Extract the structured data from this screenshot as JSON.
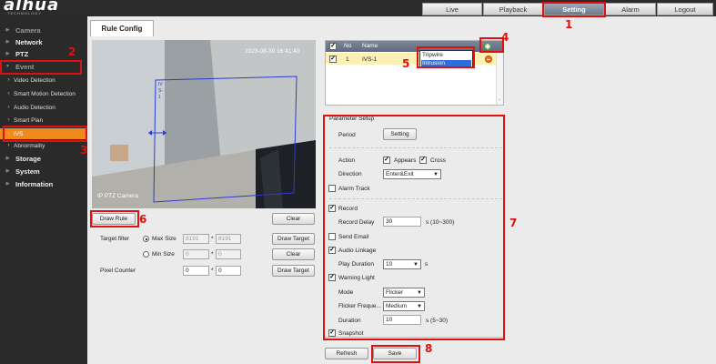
{
  "brand": {
    "logo": "alhua",
    "sub": "TECHNOLOGY"
  },
  "topnav": [
    {
      "label": "Live"
    },
    {
      "label": "Playback"
    },
    {
      "label": "Setting"
    },
    {
      "label": "Alarm"
    },
    {
      "label": "Logout"
    }
  ],
  "sidebar": {
    "camera": "Camera",
    "network": "Network",
    "ptz": "PTZ",
    "event": "Event",
    "video_detection": "Video Detection",
    "smart_motion": "Smart Motion Detection",
    "audio_detection": "Audio Detection",
    "smart_plan": "Smart Plan",
    "ivs": "IVS",
    "abnormality": "Abnormality",
    "storage": "Storage",
    "system": "System",
    "information": "Information"
  },
  "tab": {
    "label": "Rule Config"
  },
  "video": {
    "timestamp": "2023-08-30 16:41:40",
    "camera_label": "IP PTZ Camera",
    "rule_label": "IVS-1"
  },
  "under_video": {
    "draw_rule": "Draw Rule",
    "clear1": "Clear",
    "target_filter": "Target filter",
    "max_size": "Max Size",
    "max_w": "8191",
    "max_h": "8191",
    "draw_target1": "Draw Target",
    "min_size": "Min Size",
    "min_w": "0",
    "min_h": "0",
    "clear2": "Clear",
    "pixel_counter": "Pixel Counter",
    "pix_w": "0",
    "pix_h": "0",
    "draw_target2": "Draw Target",
    "times": "*"
  },
  "rule_table": {
    "col_no": "No",
    "col_name": "Name",
    "row_no": "1",
    "row_name": "IVS-1",
    "dropdown": [
      "Tripwire",
      "Intrusion"
    ]
  },
  "params": {
    "legend": "Parameter Setup",
    "period": "Period",
    "setting_btn": "Setting",
    "action": "Action",
    "appears": "Appears",
    "cross": "Cross",
    "direction": "Direction",
    "direction_val": "Enter&Exit",
    "alarm_track": "Alarm Track",
    "record": "Record",
    "record_delay": "Record Delay",
    "record_delay_val": "30",
    "record_delay_hint": "s (10~300)",
    "send_email": "Send Email",
    "audio_linkage": "Audio Linkage",
    "play_duration": "Play Duration",
    "play_duration_val": "10",
    "play_duration_unit": "s",
    "warning_light": "Warning Light",
    "mode": "Mode",
    "mode_val": "Flicker",
    "flicker_freq": "Flicker Freque...",
    "flicker_val": "Medium",
    "duration": "Duration",
    "duration_val": "10",
    "duration_hint": "s (5~30)",
    "snapshot": "Snapshot"
  },
  "footer": {
    "refresh": "Refresh",
    "save": "Save"
  },
  "annotations": [
    "1",
    "2",
    "3",
    "4",
    "5",
    "6",
    "7",
    "8"
  ],
  "colors": {
    "accent": "#ef8b1d",
    "annotation": "#e01010",
    "sidebar": "#2a2a2a",
    "topbar": "#2b2b2b"
  }
}
